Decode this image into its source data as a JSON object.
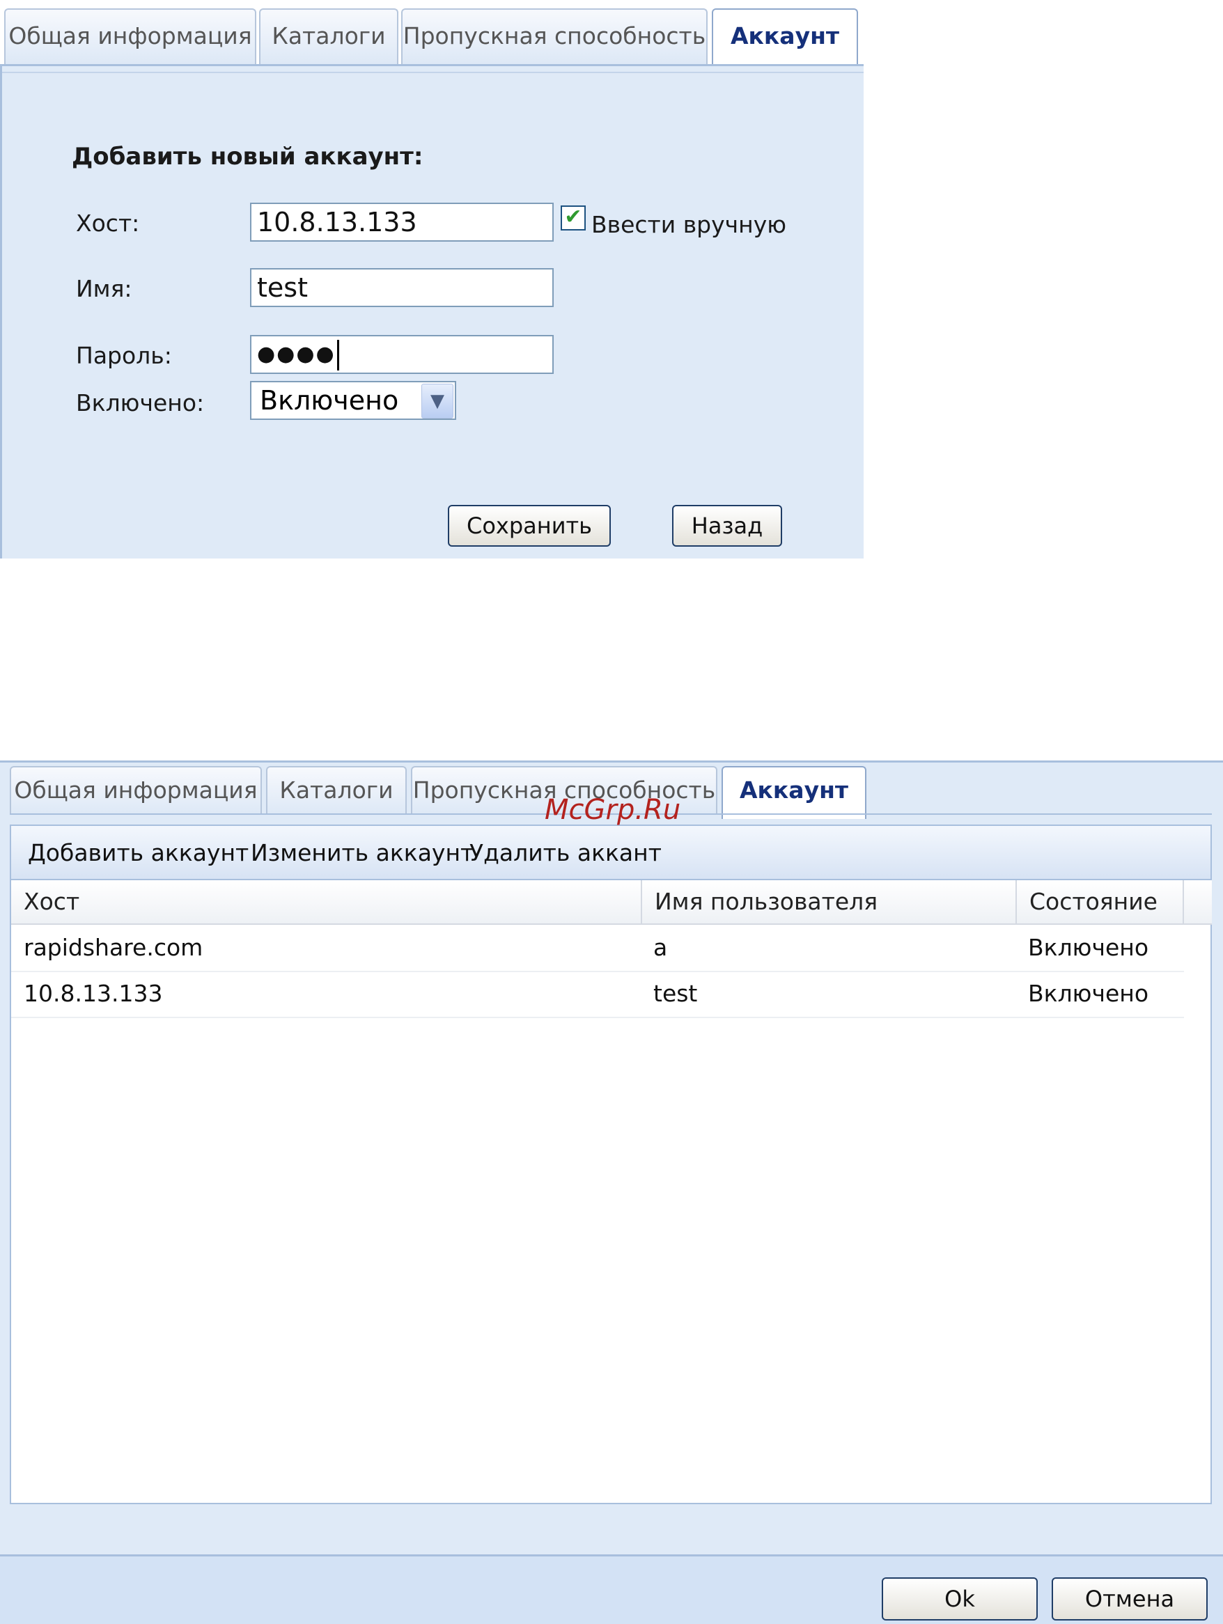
{
  "top_tabs": [
    {
      "label": "Общая информация"
    },
    {
      "label": "Каталоги"
    },
    {
      "label": "Пропускная способность"
    },
    {
      "label": "Аккаунт"
    }
  ],
  "form": {
    "title": "Добавить новый аккаунт:",
    "host_label": "Хост:",
    "host_value": "10.8.13.133",
    "manual_label": "Ввести вручную",
    "manual_checked": true,
    "name_label": "Имя:",
    "name_value": "test",
    "password_label": "Пароль:",
    "password_masked": "●●●●",
    "enabled_label": "Включено:",
    "enabled_value": "Включено",
    "save_label": "Сохранить",
    "back_label": "Назад"
  },
  "bottom_tabs": [
    {
      "label": "Общая информация"
    },
    {
      "label": "Каталоги"
    },
    {
      "label": "Пропускная способность"
    },
    {
      "label": "Аккаунт"
    }
  ],
  "toolbar": {
    "add": "Добавить аккаунт",
    "edit": "Изменить аккаунт",
    "delete": "Удалить аккант"
  },
  "table": {
    "columns": [
      "Хост",
      "Имя пользователя",
      "Состояние"
    ],
    "rows": [
      [
        "rapidshare.com",
        "a",
        "Включено"
      ],
      [
        "10.8.13.133",
        "test",
        "Включено"
      ]
    ]
  },
  "watermark": "McGrp.Ru",
  "footer": {
    "ok_label": "Ok",
    "cancel_label": "Отмена"
  },
  "colors": {
    "panel_bg": "#dfeaf7",
    "border": "#a8bfdd",
    "active_tab_text": "#15307a",
    "watermark": "#b3221e",
    "check": "#2f9a2f"
  }
}
